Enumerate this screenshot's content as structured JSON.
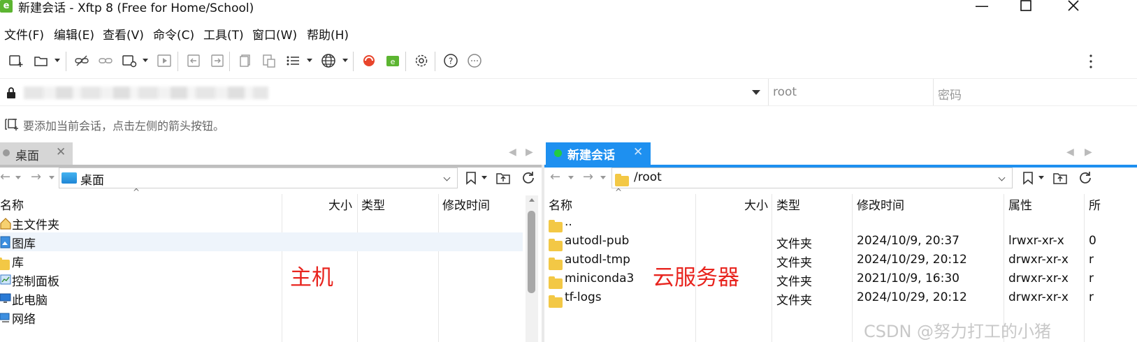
{
  "window": {
    "title": "新建会话 - Xftp 8 (Free for Home/School)",
    "app_icon": "xftp-app-icon"
  },
  "menu": [
    "文件(F)",
    "编辑(E)",
    "查看(V)",
    "命令(C)",
    "工具(T)",
    "窗口(W)",
    "帮助(H)"
  ],
  "address_bar": {
    "username": "root",
    "password_placeholder": "密码"
  },
  "hint": "要添加当前会话，点击左侧的箭头按钮。",
  "left_pane": {
    "tab_label": "桌面",
    "path": "桌面",
    "columns": [
      "名称",
      "大小",
      "类型",
      "修改时间"
    ],
    "items": [
      {
        "name": "主文件夹",
        "icon": "home-icon"
      },
      {
        "name": "图库",
        "icon": "gallery-icon"
      },
      {
        "name": "库",
        "icon": "library-folder-icon"
      },
      {
        "name": "控制面板",
        "icon": "control-panel-icon"
      },
      {
        "name": "此电脑",
        "icon": "computer-icon"
      },
      {
        "name": "网络",
        "icon": "network-icon"
      }
    ],
    "annotation": "主机"
  },
  "right_pane": {
    "tab_label": "新建会话",
    "path": "/root",
    "columns": [
      "名称",
      "大小",
      "类型",
      "修改时间",
      "属性",
      "所"
    ],
    "items": [
      {
        "name": "..",
        "type": "",
        "modified": "",
        "attr": "",
        "owner": ""
      },
      {
        "name": "autodl-pub",
        "type": "文件夹",
        "modified": "2024/10/9, 20:37",
        "attr": "lrwxr-xr-x",
        "owner": "0"
      },
      {
        "name": "autodl-tmp",
        "type": "文件夹",
        "modified": "2024/10/29, 20:12",
        "attr": "drwxr-xr-x",
        "owner": "r"
      },
      {
        "name": "miniconda3",
        "type": "文件夹",
        "modified": "2021/10/9, 16:30",
        "attr": "drwxr-xr-x",
        "owner": "r"
      },
      {
        "name": "tf-logs",
        "type": "文件夹",
        "modified": "2024/10/29, 20:12",
        "attr": "drwxr-xr-x",
        "owner": "r"
      }
    ],
    "annotation": "云服务器"
  },
  "watermark": "CSDN @努力打工的小猪",
  "colors": {
    "accent": "#1e90f0",
    "annotation": "#e8251f",
    "session_dot": "#22cc44"
  }
}
